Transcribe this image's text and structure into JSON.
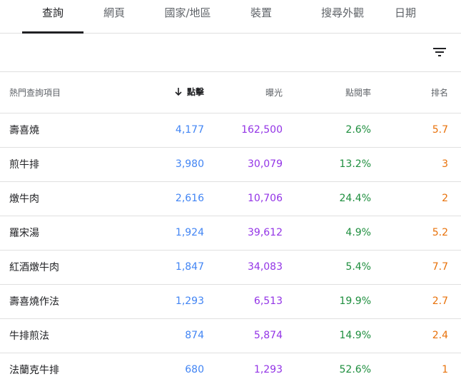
{
  "tabs": [
    {
      "label": "查詢"
    },
    {
      "label": "網頁"
    },
    {
      "label": "國家/地區"
    },
    {
      "label": "裝置"
    },
    {
      "label": "搜尋外觀"
    },
    {
      "label": "日期"
    }
  ],
  "active_tab": 0,
  "toolbar": {
    "filter_icon": "filter-list-icon"
  },
  "table": {
    "headers": {
      "query": "熱門查詢項目",
      "clicks": "點擊",
      "impressions": "曝光",
      "ctr": "點閱率",
      "position": "排名"
    },
    "sorted_by": "clicks",
    "sort_direction": "descending",
    "rows": [
      {
        "query": "壽喜燒",
        "clicks": "4,177",
        "impressions": "162,500",
        "ctr": "2.6%",
        "position": "5.7"
      },
      {
        "query": "煎牛排",
        "clicks": "3,980",
        "impressions": "30,079",
        "ctr": "13.2%",
        "position": "3"
      },
      {
        "query": "燉牛肉",
        "clicks": "2,616",
        "impressions": "10,706",
        "ctr": "24.4%",
        "position": "2"
      },
      {
        "query": "羅宋湯",
        "clicks": "1,924",
        "impressions": "39,612",
        "ctr": "4.9%",
        "position": "5.2"
      },
      {
        "query": "紅酒燉牛肉",
        "clicks": "1,847",
        "impressions": "34,083",
        "ctr": "5.4%",
        "position": "7.7"
      },
      {
        "query": "壽喜燒作法",
        "clicks": "1,293",
        "impressions": "6,513",
        "ctr": "19.9%",
        "position": "2.7"
      },
      {
        "query": "牛排煎法",
        "clicks": "874",
        "impressions": "5,874",
        "ctr": "14.9%",
        "position": "2.4"
      },
      {
        "query": "法蘭克牛排",
        "clicks": "680",
        "impressions": "1,293",
        "ctr": "52.6%",
        "position": "1"
      }
    ]
  },
  "colors": {
    "clicks": "#4285f4",
    "impressions": "#9334e6",
    "ctr": "#1e8e3e",
    "position": "#e8710a"
  }
}
